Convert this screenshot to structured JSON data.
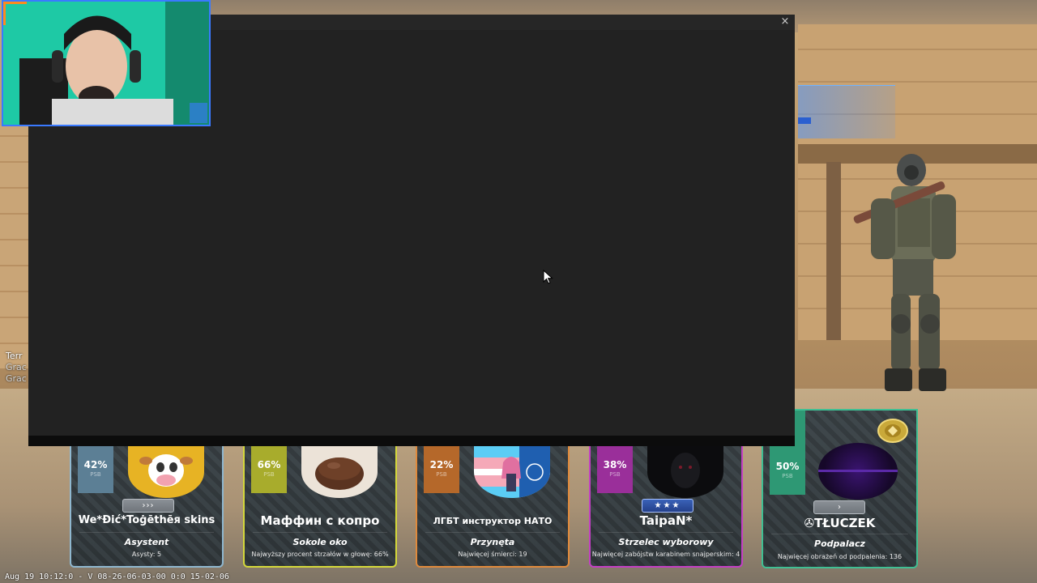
{
  "popup": {
    "close_glyph": "×"
  },
  "hud_left": {
    "line1": "Terr",
    "line2": "Grac",
    "line3": "Grac"
  },
  "cards": [
    {
      "percent": "42%",
      "psb": "PSB",
      "rank": "›››",
      "name": "We*Ðić*Toġēthēя skins",
      "title": "Asystent",
      "stat": "Asysty: 5",
      "color": "#8fb7cf",
      "stripe_color": "#5c7f95"
    },
    {
      "percent": "66%",
      "psb": "PSB",
      "rank": "",
      "name": "Маффин с копро",
      "title": "Sokole oko",
      "stat": "Najwyższy procent strzałów w głowę: 66%",
      "color": "#d4d83a",
      "stripe_color": "#a8ac2c"
    },
    {
      "percent": "22%",
      "psb": "PSB",
      "rank": "",
      "name": "ЛГБТ инструктор НАТО",
      "title": "Przynęta",
      "stat": "Najwięcej śmierci: 19",
      "color": "#e08a3c",
      "stripe_color": "#b5682a"
    },
    {
      "percent": "38%",
      "psb": "PSB",
      "rank": "★★★",
      "name": "TaipaN*",
      "title": "Strzelec wyborowy",
      "stat": "Najwięcej zabójstw karabinem snajperskim: 4",
      "color": "#c43fc4",
      "stripe_color": "#9a2f9a"
    },
    {
      "percent": "50%",
      "psb": "PSB",
      "rank": "›",
      "name": "✇TŁUCZEK",
      "title": "Podpalacz",
      "stat": "Najwięcej obrażeń od podpalenia: 136",
      "color": "#3fbf93",
      "stripe_color": "#2e9874"
    }
  ],
  "bottom": {
    "text": "Aug 19 10:12:0 - V 08-26-06-03-00 0:0 15-02-06"
  },
  "icons": {
    "close": "close-icon",
    "cursor": "mouse-cursor-icon",
    "badge": "rank-badge-icon"
  }
}
